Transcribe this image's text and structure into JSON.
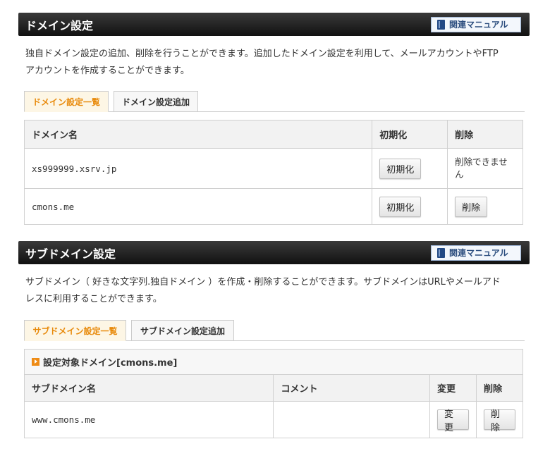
{
  "domain_section": {
    "title": "ドメイン設定",
    "manual_label": "関連マニュアル",
    "description_line1": "独自ドメイン設定の追加、削除を行うことができます。追加したドメイン設定を利用して、メールアカウントやFTP",
    "description_line2": "アカウントを作成することができます。",
    "tabs": [
      {
        "label": "ドメイン設定一覧",
        "active": true
      },
      {
        "label": "ドメイン設定追加",
        "active": false
      }
    ],
    "table": {
      "headers": [
        "ドメイン名",
        "初期化",
        "削除"
      ],
      "rows": [
        {
          "domain": "xs999999.xsrv.jp",
          "init_label": "初期化",
          "delete_text_line1": "削除できませ",
          "delete_text_line2": "ん"
        },
        {
          "domain": "cmons.me",
          "init_label": "初期化",
          "delete_label": "削除"
        }
      ]
    }
  },
  "subdomain_section": {
    "title": "サブドメイン設定",
    "manual_label": "関連マニュアル",
    "description_line1": "サブドメイン（ 好きな文字列.独自ドメイン ）を作成・削除することができます。サブドメインはURLやメールアド",
    "description_line2": "レスに利用することができます。",
    "tabs": [
      {
        "label": "サブドメイン設定一覧",
        "active": true
      },
      {
        "label": "サブドメイン設定追加",
        "active": false
      }
    ],
    "target_domain_label": "設定対象ドメイン[cmons.me]",
    "table": {
      "headers": [
        "サブドメイン名",
        "コメント",
        "変更",
        "削除"
      ],
      "rows": [
        {
          "subdomain": "www.cmons.me",
          "comment": "",
          "change_label": "変更",
          "delete_label": "削除"
        }
      ]
    }
  },
  "colors": {
    "header_bg": "#1a1a1a",
    "active_tab_text": "#e88a0b",
    "manual_button_text": "#2b4d7e"
  }
}
